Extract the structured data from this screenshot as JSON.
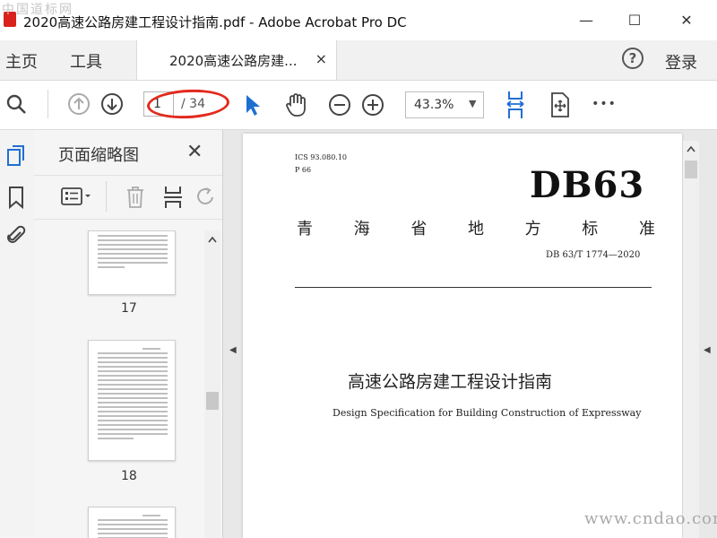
{
  "window": {
    "title": "2020高速公路房建工程设计指南.pdf - Adobe Acrobat Pro DC",
    "watermark_top": "中国道标网",
    "minimize_glyph": "—",
    "maximize_glyph": "☐",
    "close_glyph": "✕"
  },
  "tabbar": {
    "home_label": "主页",
    "tools_label": "工具",
    "doc_tab_label": "2020高速公路房建...",
    "doc_tab_close": "×",
    "help_icon": "?",
    "login_label": "登录"
  },
  "toolbar": {
    "icons": [
      "search-icon",
      "prev-page-icon",
      "next-page-icon",
      "select-cursor-icon",
      "hand-tool-icon",
      "zoom-out-icon",
      "zoom-in-icon",
      "fit-width-icon",
      "fit-page-icon",
      "more-icon"
    ],
    "current_page": "1",
    "page_total": "/ 34",
    "zoom_value": "43.3%",
    "zoom_caret": "▼",
    "more_glyph": "•••",
    "accent_color": "#1f6fd1",
    "annotation_color": "#e22a1e"
  },
  "panel": {
    "title": "页面缩略图",
    "close_glyph": "✕",
    "thumbnails": [
      {
        "label": "17"
      },
      {
        "label": "18"
      }
    ]
  },
  "document": {
    "ics": "ICS 93.080.10",
    "p_number": "P 66",
    "db_code": "DB63",
    "province_chars": [
      "青",
      "海",
      "省",
      "地",
      "方",
      "标",
      "准"
    ],
    "standard_number": "DB 63/T  1774—2020",
    "title_cn": "高速公路房建工程设计指南",
    "title_en": "Design Specification for Building Construction of Expressway"
  },
  "watermark_bottom": "www.cndao.com"
}
